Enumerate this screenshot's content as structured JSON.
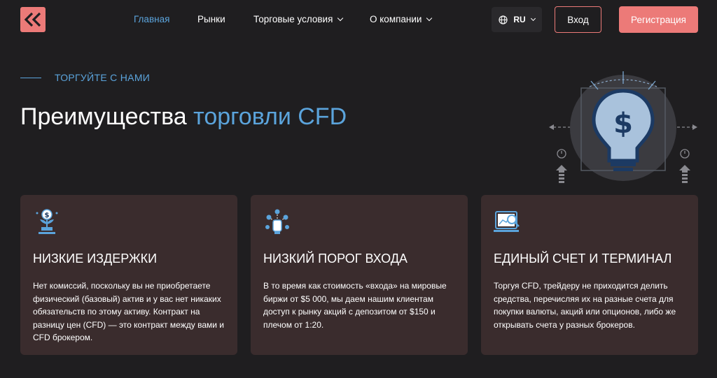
{
  "nav": {
    "items": [
      {
        "label": "Главная",
        "active": true,
        "dropdown": false
      },
      {
        "label": "Рынки",
        "active": false,
        "dropdown": false
      },
      {
        "label": "Торговые условия",
        "active": false,
        "dropdown": true
      },
      {
        "label": "О компании",
        "active": false,
        "dropdown": true
      }
    ]
  },
  "lang": {
    "label": "RU",
    "icon": "globe-icon"
  },
  "auth": {
    "login_label": "Вход",
    "register_label": "Регистрация"
  },
  "hero": {
    "eyebrow": "ТОРГУЙТЕ С НАМИ",
    "title_main": "Преимущества ",
    "title_accent": "торговли CFD"
  },
  "cards": [
    {
      "icon": "money-plant-icon",
      "title": "НИЗКИЕ ИЗДЕРЖКИ",
      "text": "Нет комиссий, поскольку вы не приобретаете физический (базовый) актив и у вас нет никаких обязательств по этому активу. Контракт на разницу цен (CFD) — это контракт между вами и CFD брокером."
    },
    {
      "icon": "hand-coins-icon",
      "title": "НИЗКИЙ ПОРОГ ВХОДА",
      "text": "В то время как стоимость «входа» на мировые биржи от $5 000, мы даем нашим клиентам доступ к рынку акций с депозитом от $150 и плечом от 1:20."
    },
    {
      "icon": "trading-terminal-icon",
      "title": "ЕДИНЫЙ СЧЕТ И ТЕРМИНАЛ",
      "text": "Торгуя CFD, трейдеру не приходится делить средства, перечисляя их на разные счета для покупки валюты, акций или опционов, либо же открывать счета у разных брокеров."
    }
  ],
  "colors": {
    "background": "#1f1e20",
    "accent": "#ec7a78",
    "blue": "#5ba4dc",
    "card": "#3a2c2d"
  }
}
